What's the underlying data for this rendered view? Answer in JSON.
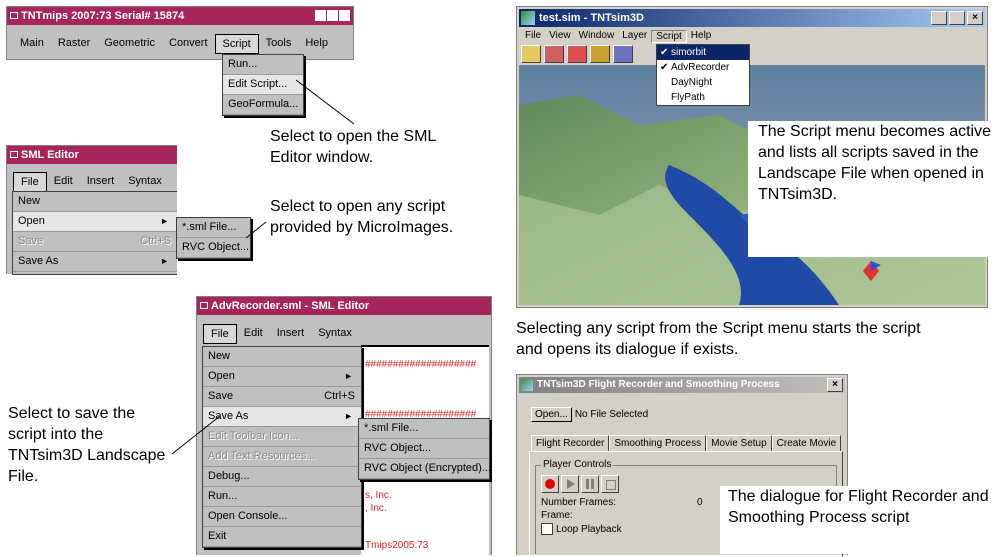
{
  "win_main": {
    "title": "TNTmips 2007:73  Serial# 15874",
    "menu": [
      "Main",
      "Raster",
      "Geometric",
      "Convert",
      "Script",
      "Tools",
      "Help"
    ],
    "script_menu": [
      "Run...",
      "Edit Script...",
      "GeoFormula..."
    ]
  },
  "caption_edit": "Select to open the SML Editor window.",
  "win_sml": {
    "title": "SML Editor",
    "menu": [
      "File",
      "Edit",
      "Insert",
      "Syntax"
    ],
    "file_menu": {
      "new": "New",
      "open": "Open",
      "save": "Save",
      "save_shortcut": "Ctrl+S",
      "save_as": "Save As"
    },
    "open_sub": [
      "*.sml File...",
      "RVC Object..."
    ]
  },
  "caption_open": "Select to open any script provided by MicroImages.",
  "win_adv": {
    "title": "AdvRecorder.sml - SML Editor",
    "menu": [
      "File",
      "Edit",
      "Insert",
      "Syntax"
    ],
    "file_menu": {
      "new": "New",
      "open": "Open",
      "save": "Save",
      "save_shortcut": "Ctrl+S",
      "save_as": "Save As",
      "edit_toolbar": "Edit Toolbar Icon...",
      "add_text": "Add Text Resources...",
      "debug": "Debug...",
      "run": "Run...",
      "open_console": "Open Console...",
      "exit": "Exit"
    },
    "saveas_sub": [
      "*.sml File...",
      "RVC Object...",
      "RVC Object (Encrypted)..."
    ],
    "bg_text": {
      "hash1": "####################",
      "hash2": "####################",
      "inc1": "s, Inc.",
      "inc2": ", Inc.",
      "ver": "Tmips2005:73"
    }
  },
  "caption_save": "Select to save the script into the TNTsim3D Landscape File.",
  "win_sim": {
    "title": "test.sim - TNTsim3D",
    "menu": [
      "File",
      "View",
      "Window",
      "Layer",
      "Script",
      "Help"
    ],
    "script_menu": [
      {
        "label": "simorbit",
        "checked": true
      },
      {
        "label": "AdvRecorder",
        "checked": true
      },
      {
        "label": "DayNight",
        "checked": false
      },
      {
        "label": "FlyPath",
        "checked": false
      }
    ]
  },
  "caption_script": "The Script menu becomes active and lists all scripts saved in the Landscape File when opened in TNTsim3D.",
  "caption_selecting": "Selecting any script from the Script menu starts the script and opens its dialogue if exists.",
  "win_dlg": {
    "title": "TNTsim3D Flight Recorder and Smoothing Process",
    "open_button": "Open...",
    "file_status": "No File Selected",
    "tabs": [
      "Flight Recorder",
      "Smoothing Process",
      "Movie Setup",
      "Create Movie"
    ],
    "group_label": "Player Controls",
    "frames_label": "Number Frames:",
    "frames_value": "0",
    "frame_label": "Frame:",
    "loop_label": "Loop Playback"
  },
  "caption_dialogue": "The dialogue for Flight Recorder and Smoothing Process script",
  "colors": {
    "title_bar": "#a6265a",
    "win_bg": "#c0c0c0",
    "win2000_title": "#0a246a",
    "highlight": "#0a246a"
  }
}
